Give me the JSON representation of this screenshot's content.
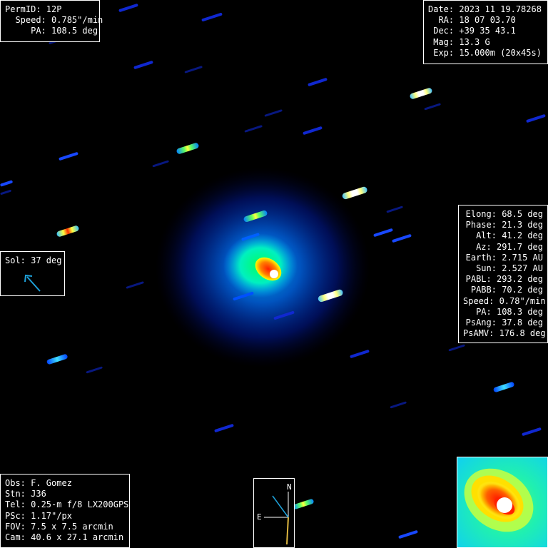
{
  "image": {
    "background_color": "#000000",
    "colormap": [
      "#000010",
      "#0010c0",
      "#0060ff",
      "#00d0ff",
      "#40ff80",
      "#ffff00",
      "#ff3000",
      "#ffffff"
    ]
  },
  "info_top_left": {
    "lines": [
      "PermID: 12P",
      "  Speed: 0.785\"/min",
      "     PA: 108.5 deg"
    ]
  },
  "info_top_right": {
    "lines": [
      "Date: 2023 11 19.78268",
      "  RA: 18 07 03.70",
      " Dec: +39 35 43.1",
      " Mag: 13.3 G",
      " Exp: 15.000m (20x45s)"
    ]
  },
  "info_right": {
    "lines": [
      "Elong: 68.5 deg",
      "Phase: 21.3 deg",
      "Alt: 41.2 deg",
      "Az: 291.7 deg",
      "Earth: 2.715 AU",
      "Sun: 2.527 AU",
      "PABL: 293.2 deg",
      "PABB: 70.2 deg",
      "Speed: 0.78\"/min",
      "PA: 108.3 deg",
      "PsAng: 37.8 deg",
      "PsAMV: 176.8 deg"
    ]
  },
  "solar_indicator": {
    "label": "Sol: 37 deg",
    "arrow_color": "#1ea0d8"
  },
  "info_bottom_left": {
    "lines": [
      "Obs: F. Gomez",
      "Stn: J36",
      "Tel: 0.25-m f/8 LX200GPS",
      "PSc: 1.17\"/px",
      "FOV: 7.5 x 7.5 arcmin",
      "Cam: 40.6 x 27.1 arcmin"
    ]
  },
  "compass": {
    "north_label": "N",
    "east_label": "E",
    "north_line_color": "#ffffff",
    "motion_line_color": "#e0b840",
    "sun_line_color": "#1ea0d8"
  }
}
